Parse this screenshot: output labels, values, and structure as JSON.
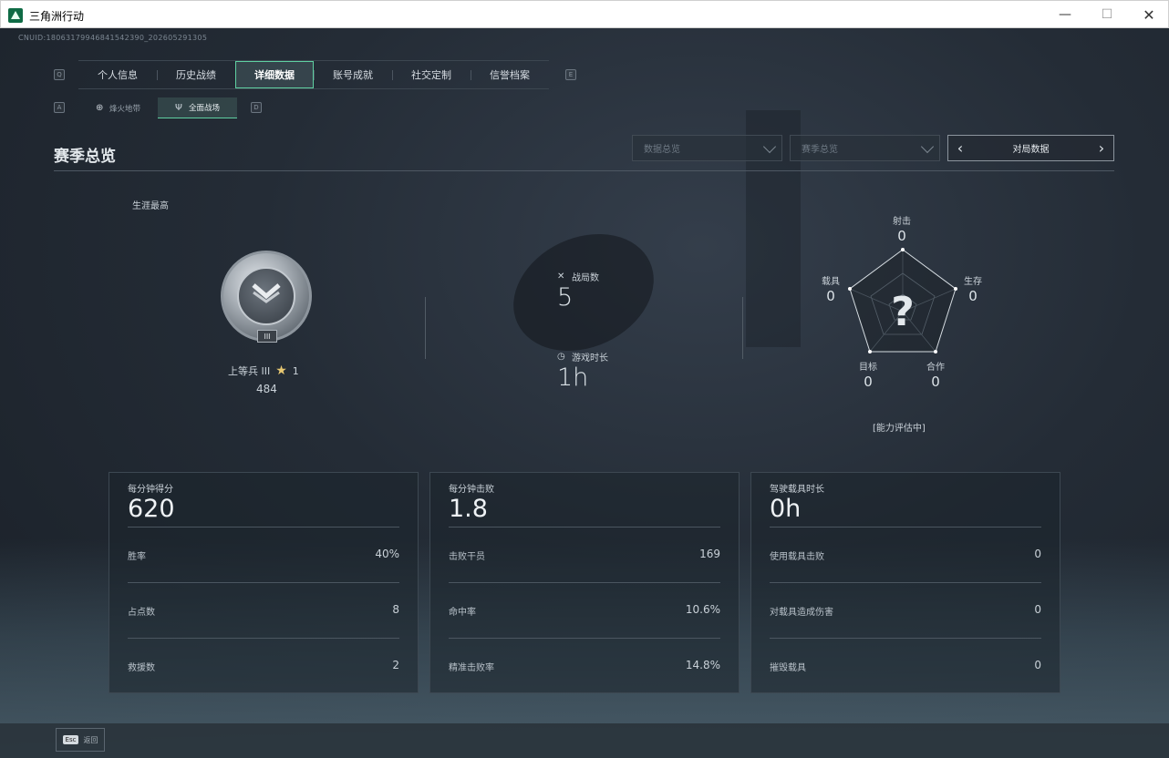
{
  "window": {
    "title": "三角洲行动",
    "minimize": "—",
    "maximize": "☐",
    "close": "✕"
  },
  "cnuid": "CNUID:18063179946841542390_202605291305",
  "tabs": {
    "left_key": "Q",
    "right_key": "E",
    "items": [
      {
        "label": "个人信息",
        "active": false
      },
      {
        "label": "历史战绩",
        "active": false
      },
      {
        "label": "详细数据",
        "active": true
      },
      {
        "label": "账号成就",
        "active": false
      },
      {
        "label": "社交定制",
        "active": false
      },
      {
        "label": "信誉档案",
        "active": false
      }
    ]
  },
  "subtabs": {
    "left_key": "A",
    "right_key": "D",
    "items": [
      {
        "label": "烽火地带",
        "icon": "zone-icon",
        "active": false
      },
      {
        "label": "全面战场",
        "icon": "battlefield-icon",
        "active": true
      }
    ]
  },
  "section": {
    "title": "赛季总览",
    "dropdown1": "数据总览",
    "dropdown2": "赛季总览",
    "pager_label": "对局数据"
  },
  "career": {
    "label": "生涯最高",
    "rank_name": "上等兵 III",
    "stars": "1",
    "score": "484",
    "badge_tier": "III"
  },
  "stats": {
    "matches_label": "战局数",
    "matches_value": "5",
    "playtime_label": "游戏时长",
    "playtime_value": "1h"
  },
  "radar": {
    "axes": [
      {
        "label": "射击",
        "value": "0"
      },
      {
        "label": "生存",
        "value": "0"
      },
      {
        "label": "合作",
        "value": "0"
      },
      {
        "label": "目标",
        "value": "0"
      },
      {
        "label": "载具",
        "value": "0"
      }
    ],
    "center_mark": "?",
    "status": "[能力评估中]"
  },
  "cards": [
    {
      "title": "每分钟得分",
      "value": "620",
      "rows": [
        {
          "label": "胜率",
          "value": "40%"
        },
        {
          "label": "占点数",
          "value": "8"
        },
        {
          "label": "救援数",
          "value": "2"
        }
      ]
    },
    {
      "title": "每分钟击败",
      "value": "1.8",
      "rows": [
        {
          "label": "击败干员",
          "value": "169"
        },
        {
          "label": "命中率",
          "value": "10.6%"
        },
        {
          "label": "精准击败率",
          "value": "14.8%"
        }
      ]
    },
    {
      "title": "驾驶载具时长",
      "value": "0h",
      "rows": [
        {
          "label": "使用载具击败",
          "value": "0"
        },
        {
          "label": "对载具造成伤害",
          "value": "0"
        },
        {
          "label": "摧毁载具",
          "value": "0"
        }
      ]
    }
  ],
  "footer": {
    "esc_key": "Esc",
    "esc_label": "返回"
  },
  "colors": {
    "accent": "#5fd0a2",
    "star": "#e8c872",
    "background": "#242c36"
  }
}
